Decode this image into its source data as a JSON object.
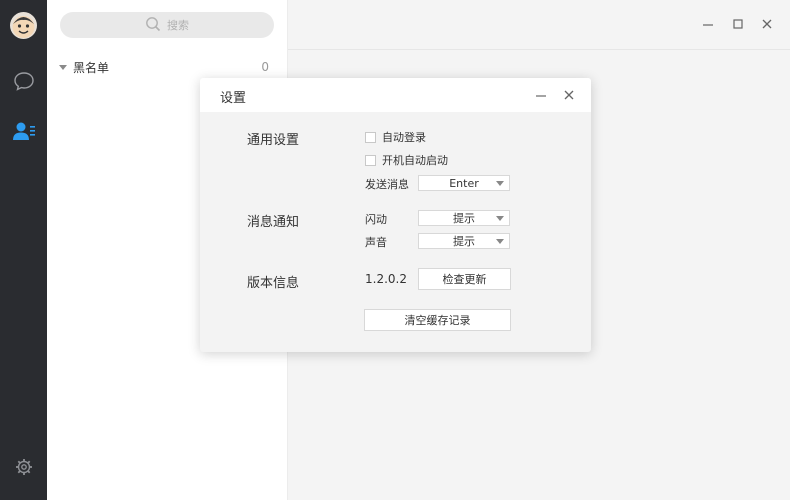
{
  "sidebar": {
    "icons": [
      "avatar",
      "chat-bubble-icon",
      "contacts-icon",
      "gear-icon"
    ]
  },
  "contacts": {
    "search_placeholder": "搜索",
    "groups": [
      {
        "name": "黑名单",
        "count": "0"
      }
    ]
  },
  "window": {
    "controls": [
      "minimize",
      "maximize",
      "close"
    ]
  },
  "settings": {
    "title": "设置",
    "general": {
      "label": "通用设置",
      "auto_login": "自动登录",
      "auto_start": "开机自动启动",
      "send_label": "发送消息",
      "send_value": "Enter"
    },
    "notify": {
      "label": "消息通知",
      "flash_label": "闪动",
      "flash_value": "提示",
      "sound_label": "声音",
      "sound_value": "提示"
    },
    "version": {
      "label": "版本信息",
      "number": "1.2.0.2",
      "check_update": "检查更新"
    },
    "clear_cache": "清空缓存记录"
  },
  "colors": {
    "rail": "#2a2c30",
    "accent": "#2d9cf0"
  }
}
